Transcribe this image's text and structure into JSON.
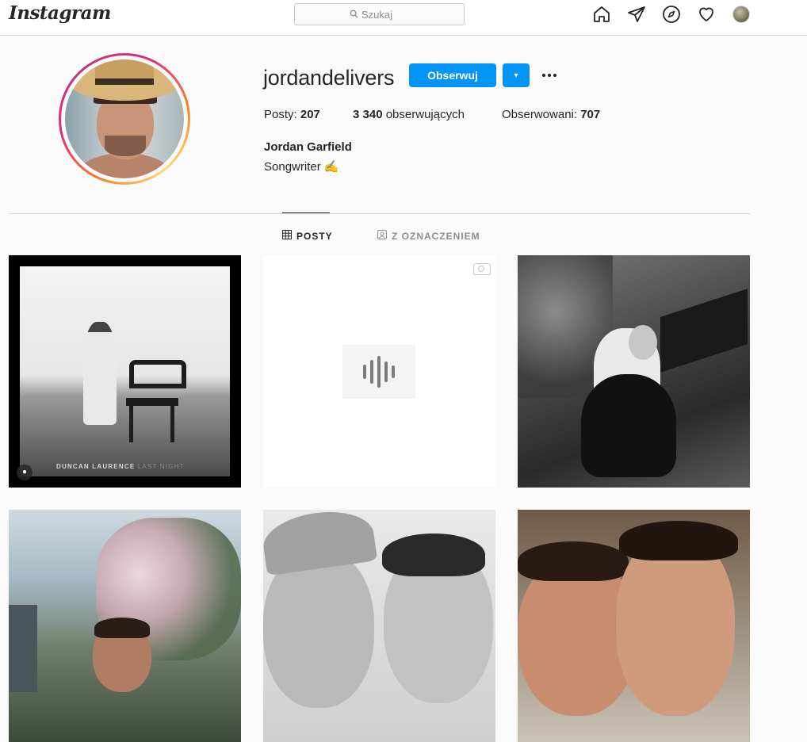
{
  "header": {
    "logo": "Instagram",
    "search_placeholder": "Szukaj",
    "nav_icons": [
      "home-icon",
      "direct-icon",
      "explore-icon",
      "activity-icon",
      "profile-avatar"
    ]
  },
  "profile": {
    "username": "jordandelivers",
    "follow_label": "Obserwuj",
    "dropdown_glyph": "▾",
    "stats": {
      "posts_label": "Posty:",
      "posts_value": "207",
      "followers_value": "3 340",
      "followers_label": "obserwujących",
      "following_label": "Obserwowani:",
      "following_value": "707"
    },
    "full_name": "Jordan Garfield",
    "bio": "Songwriter",
    "bio_emoji": "✍️"
  },
  "tabs": [
    {
      "label": "POSTY",
      "icon": "grid-icon",
      "active": true
    },
    {
      "label": "Z OZNACZENIEM",
      "icon": "tagged-icon",
      "active": false
    }
  ],
  "posts": [
    {
      "kind": "image",
      "caption_bold": "DUNCAN LAURENCE",
      "caption_light": "LAST NIGHT"
    },
    {
      "kind": "reel-audio"
    },
    {
      "kind": "image"
    },
    {
      "kind": "image"
    },
    {
      "kind": "image"
    },
    {
      "kind": "image"
    }
  ],
  "colors": {
    "accent": "#0095f6",
    "background": "#fafafa",
    "text": "#262626",
    "muted": "#8e8e8e",
    "border": "#dbdbdb"
  }
}
